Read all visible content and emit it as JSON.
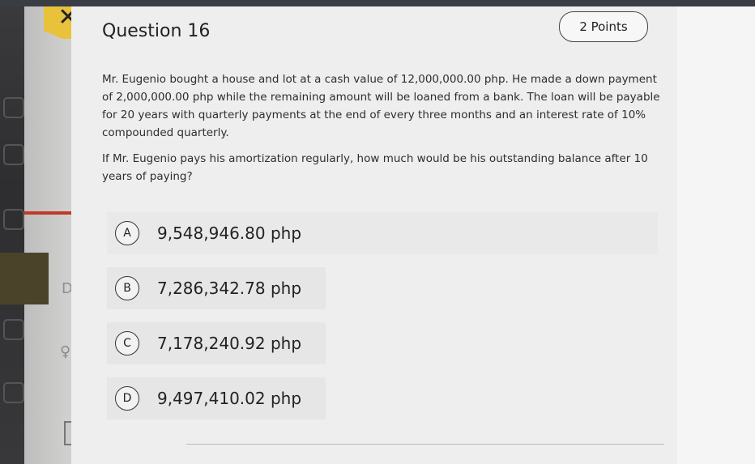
{
  "close_glyph": "✕",
  "side_letter": "D",
  "question": {
    "title": "Question 16",
    "points": "2 Points",
    "paragraph1": "Mr. Eugenio bought a house and lot at a cash value of 12,000,000.00 php. He made a down payment of 2,000,000.00 php while the remaining amount will be loaned from a bank. The loan will be payable for 20 years with quarterly payments at the end of every three months and an interest rate of 10% compounded quarterly.",
    "paragraph2": "If Mr. Eugenio pays his amortization regularly, how much would be his outstanding balance after 10 years of paying?",
    "options": [
      {
        "letter": "A",
        "text": "9,548,946.80 php"
      },
      {
        "letter": "B",
        "text": "7,286,342.78 php"
      },
      {
        "letter": "C",
        "text": "7,178,240.92 php"
      },
      {
        "letter": "D",
        "text": "9,497,410.02 php"
      }
    ]
  },
  "colors": {
    "accent": "#e8c23a",
    "selection_red": "#c0392b"
  }
}
